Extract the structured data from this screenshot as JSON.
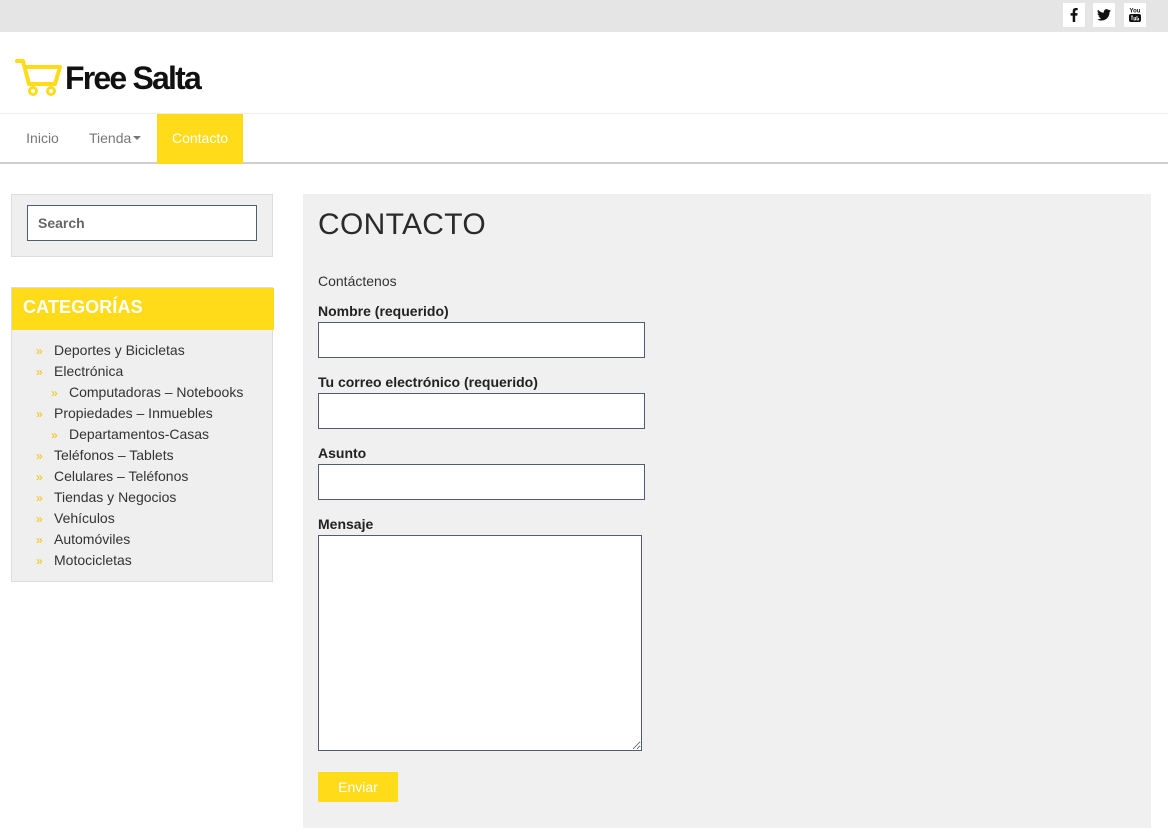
{
  "social": {
    "icons": [
      "facebook-icon",
      "twitter-icon",
      "youtube-icon"
    ],
    "youtube_label": "You"
  },
  "brand": {
    "name": "Free Salta",
    "icon": "shopping-cart-icon",
    "accent_color": "#ffdb1a"
  },
  "nav": {
    "items": [
      {
        "label": "Inicio"
      },
      {
        "label": "Tienda",
        "has_dropdown": true
      },
      {
        "label": "Contacto",
        "active": true
      }
    ]
  },
  "sidebar": {
    "search": {
      "placeholder": "Search",
      "value": ""
    },
    "categories": {
      "title": "CATEGORÍAS",
      "items": [
        {
          "label": "Deportes y Bicicletas",
          "level": 0
        },
        {
          "label": "Electrónica",
          "level": 0
        },
        {
          "label": "Computadoras – Notebooks",
          "level": 1
        },
        {
          "label": "Propiedades – Inmuebles",
          "level": 0
        },
        {
          "label": "Departamentos-Casas",
          "level": 1
        },
        {
          "label": "Teléfonos – Tablets",
          "level": 0
        },
        {
          "label": "Celulares – Teléfonos",
          "level": 0
        },
        {
          "label": "Tiendas y Negocios",
          "level": 0
        },
        {
          "label": "Vehículos",
          "level": 0
        },
        {
          "label": "Automóviles",
          "level": 0
        },
        {
          "label": "Motocicletas",
          "level": 0
        }
      ],
      "bullet": "»"
    }
  },
  "main": {
    "title": "CONTACTO",
    "intro": "Contáctenos",
    "form": {
      "name_label": "Nombre (requerido)",
      "name_value": "",
      "email_label": "Tu correo electrónico (requerido)",
      "email_value": "",
      "subject_label": "Asunto",
      "subject_value": "",
      "message_label": "Mensaje",
      "message_value": "",
      "submit_label": "Enviar"
    }
  }
}
